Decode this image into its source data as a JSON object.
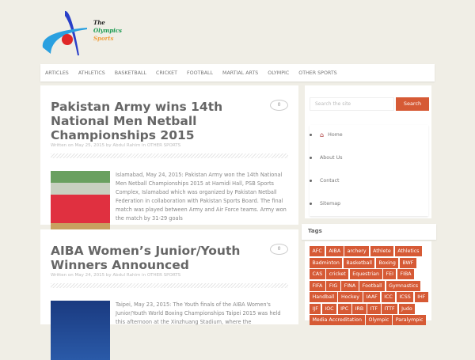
{
  "logo": {
    "line1": "The",
    "line2": "Olympics",
    "line3": "Sports"
  },
  "nav": [
    "ARTICLES",
    "ATHLETICS",
    "BASKETBALL",
    "CRICKET",
    "FOOTBALL",
    "MARTIAL ARTS",
    "OLYMPIC",
    "OTHER SPORTS"
  ],
  "posts": [
    {
      "title": "Pakistan Army wins 14th National Men Netball Championships 2015",
      "meta": "Written on May 25, 2015 by Abdul Rahim in OTHER SPORTS",
      "comments": "0",
      "excerpt": "Islamabad, May 24, 2015: Pakistan Army won the 14th National Men Netball Championships 2015 at Hamidi Hall, PSB Sports Complex, Islamabad which was organized by Pakistan Netball Federation in collaboration with Pakistan Sports Board. The final match was played between Army and Air Force teams. Army won the match by 31-29 goals"
    },
    {
      "title": "AIBA Women’s Junior/Youth Winners Announced",
      "meta": "Written on May 24, 2015 by Abdul Rahim in OTHER SPORTS",
      "comments": "0",
      "excerpt": "Taipei, May 23, 2015: The Youth finals of the AIBA Women's Junior/Youth World Boxing Championships Taipei 2015 was held this afternoon at the Xinzhuang Stadium, where the"
    }
  ],
  "sidebar": {
    "search_placeholder": "Search the site",
    "search_label": "Search",
    "links": [
      "Home",
      "About Us",
      "Contact",
      "Sitemap"
    ]
  },
  "tags": {
    "title": "Tags",
    "items": [
      "AFC",
      "AIBA",
      "archery",
      "Athlete",
      "Athletics",
      "Badminton",
      "Basketball",
      "Boxing",
      "BWF",
      "CAS",
      "cricket",
      "Equestrian",
      "FEI",
      "FIBA",
      "FIFA",
      "FIG",
      "FINA",
      "Football",
      "Gymnastics",
      "Handball",
      "Hockey",
      "IAAF",
      "ICC",
      "ICSS",
      "IHF",
      "IJF",
      "IOC",
      "IPC",
      "IRB",
      "ITF",
      "ITTF",
      "Judo",
      "Media Accreditation",
      "Olympic",
      "Paralympic"
    ]
  },
  "colors": {
    "accent": "#d65a35",
    "background": "#f0eee6"
  }
}
